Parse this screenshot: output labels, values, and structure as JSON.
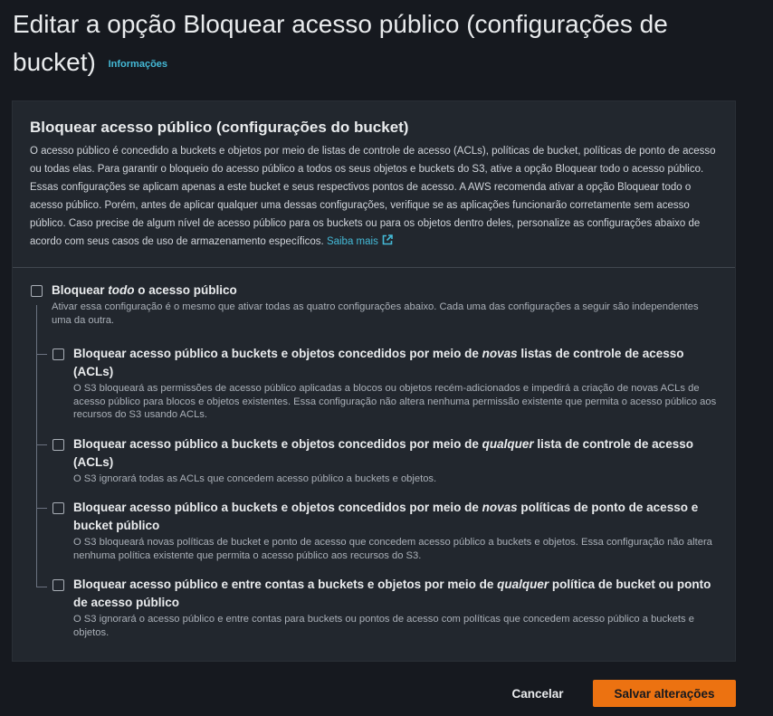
{
  "page": {
    "title": "Editar a opção Bloquear acesso público (configurações de bucket)",
    "info_link": "Informações"
  },
  "panel": {
    "heading": "Bloquear acesso público (configurações do bucket)",
    "description": "O acesso público é concedido a buckets e objetos por meio de listas de controle de acesso (ACLs), políticas de bucket, políticas de ponto de acesso ou todas elas. Para garantir o bloqueio do acesso público a todos os seus objetos e buckets do S3, ative a opção Bloquear todo o acesso público. Essas configurações se aplicam apenas a este bucket e seus respectivos pontos de acesso. A AWS recomenda ativar a opção Bloquear todo o acesso público. Porém, antes de aplicar qualquer uma dessas configurações, verifique se as aplicações funcionarão corretamente sem acesso público. Caso precise de algum nível de acesso público para os buckets ou para os objetos dentro deles, personalize as configurações abaixo de acordo com seus casos de uso de armazenamento específicos.",
    "learn_more": "Saiba mais"
  },
  "block_all": {
    "title_pre": "Bloquear ",
    "title_em": "todo",
    "title_post": " o acesso público",
    "description": "Ativar essa configuração é o mesmo que ativar todas as quatro configurações abaixo. Cada uma das configurações a seguir são independentes uma da outra.",
    "checked": false
  },
  "options": [
    {
      "title_pre": "Bloquear acesso público a buckets e objetos concedidos por meio de ",
      "title_em": "novas",
      "title_post": " listas de controle de acesso (ACLs)",
      "description": "O S3 bloqueará as permissões de acesso público aplicadas a blocos ou objetos recém-adicionados e impedirá a criação de novas ACLs de acesso público para blocos e objetos existentes. Essa configuração não altera nenhuma permissão existente que permita o acesso público aos recursos do S3 usando ACLs.",
      "checked": false
    },
    {
      "title_pre": "Bloquear acesso público a buckets e objetos concedidos por meio de ",
      "title_em": "qualquer",
      "title_post": " lista de controle de acesso (ACLs)",
      "description": "O S3 ignorará todas as ACLs que concedem acesso público a buckets e objetos.",
      "checked": false
    },
    {
      "title_pre": "Bloquear acesso público a buckets e objetos concedidos por meio de ",
      "title_em": "novas",
      "title_post": " políticas de ponto de acesso e bucket público",
      "description": "O S3 bloqueará novas políticas de bucket e ponto de acesso que concedem acesso público a buckets e objetos. Essa configuração não altera nenhuma política existente que permita o acesso público aos recursos do S3.",
      "checked": false
    },
    {
      "title_pre": "Bloquear acesso público e entre contas a buckets e objetos por meio de ",
      "title_em": "qualquer",
      "title_post": " política de bucket ou ponto de acesso público",
      "description": "O S3 ignorará o acesso público e entre contas para buckets ou pontos de acesso com políticas que concedem acesso público a buckets e objetos.",
      "checked": false
    }
  ],
  "footer": {
    "cancel_label": "Cancelar",
    "save_label": "Salvar alterações"
  },
  "colors": {
    "background": "#16191f",
    "panel": "#22272e",
    "link": "#44b9d6",
    "primary_button": "#ec7211"
  }
}
